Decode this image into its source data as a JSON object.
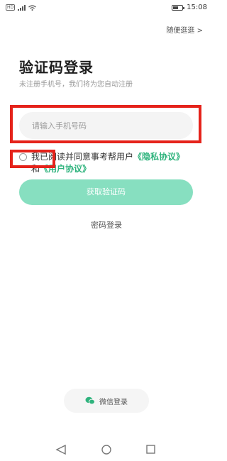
{
  "status_bar": {
    "time": "15:08",
    "battery_level": "57",
    "network_chip": "HD"
  },
  "top": {
    "browse_link": "随便逛逛 >"
  },
  "login": {
    "title": "验证码登录",
    "subtitle": "未注册手机号，我们将为您自动注册",
    "phone_placeholder": "请输入手机号码",
    "agreement_prefix": "我已阅读并同意事考帮用户",
    "privacy_link": "《隐私协议》",
    "agreement_and": "和",
    "user_link": "《用户协议》",
    "get_code_button": "获取验证码",
    "password_login": "密码登录",
    "wechat_login": "微信登录"
  },
  "colors": {
    "accent": "#2fb37d",
    "button": "#87dfc0",
    "highlight": "#e5231b"
  },
  "icons": [
    "wechat-icon",
    "wifi-icon",
    "signal-icon",
    "battery-icon",
    "nav-back-icon",
    "nav-home-icon",
    "nav-recents-icon"
  ]
}
